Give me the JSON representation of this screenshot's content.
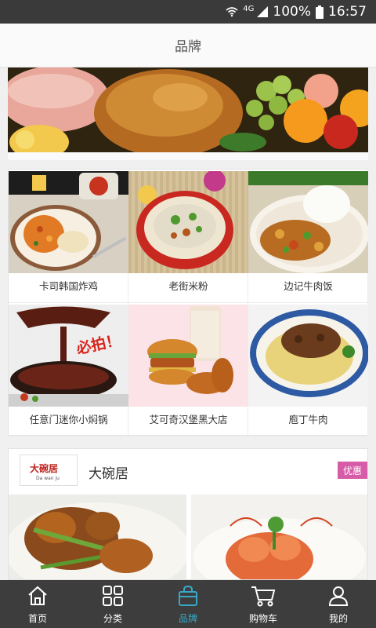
{
  "status_bar": {
    "network": "4G",
    "battery": "100%",
    "time": "16:57"
  },
  "header": {
    "title": "品牌"
  },
  "brands": [
    {
      "name": "卡司韩国炸鸡",
      "image": "curry-rice-plate"
    },
    {
      "name": "老街米粉",
      "image": "rice-noodle-bowl"
    },
    {
      "name": "边记牛肉饭",
      "image": "beef-rice-plate"
    },
    {
      "name": "任意门迷你小焖锅",
      "image": "sauce-pour-pot",
      "image_text": "必拍！"
    },
    {
      "name": "艾可奇汉堡黑大店",
      "image": "burger-combo"
    },
    {
      "name": "庖丁牛肉",
      "image": "beef-noodle-plate"
    }
  ],
  "store": {
    "name": "大碗居",
    "badge": "优惠",
    "logo_text": "大碗居",
    "logo_sub": "Da wan ju"
  },
  "tabbar": [
    {
      "label": "首页",
      "icon": "home-icon"
    },
    {
      "label": "分类",
      "icon": "grid-icon"
    },
    {
      "label": "品牌",
      "icon": "shopping-bag-icon",
      "active": true
    },
    {
      "label": "购物车",
      "icon": "cart-icon"
    },
    {
      "label": "我的",
      "icon": "user-icon"
    }
  ],
  "colors": {
    "status_bar": "#3a3a3a",
    "tab_bar": "#3d3d3d",
    "tab_active": "#37a8c8",
    "promo_badge": "#d65ca8"
  }
}
